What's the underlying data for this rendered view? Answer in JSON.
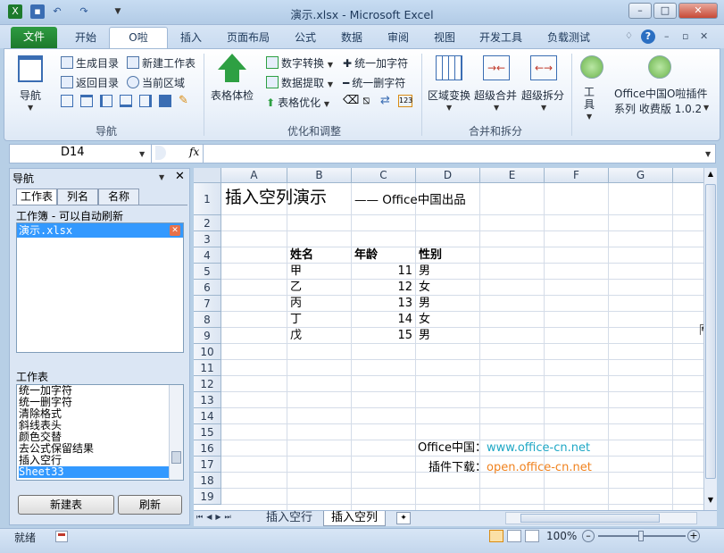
{
  "window": {
    "title": "演示.xlsx - Microsoft Excel"
  },
  "tabs": [
    "文件",
    "开始",
    "O啦",
    "插入",
    "页面布局",
    "公式",
    "数据",
    "审阅",
    "视图",
    "开发工具",
    "负载测试"
  ],
  "ribbon": {
    "nav_label": "导航",
    "nav_items": [
      "生成目录",
      "新建工作表",
      "返回目录",
      "当前区域"
    ],
    "group_nav": "导航",
    "table_check": "表格体检",
    "opt_items": [
      "数字转换",
      "统一加字符",
      "数据提取",
      "统一删字符",
      "表格优化"
    ],
    "group_opt": "优化和调整",
    "merge_items": [
      "区域变换",
      "超级合并",
      "超级拆分"
    ],
    "group_merge": "合并和拆分",
    "tools": "工具",
    "plugin_line1": "Office中国O啦插件",
    "plugin_line2": "系列 收费版 1.0.2"
  },
  "formula_bar": {
    "name_box": "D14",
    "fx": "fx"
  },
  "nav_pane": {
    "title": "导航",
    "tabs": [
      "工作表",
      "列名",
      "名称"
    ],
    "workbook_label": "工作簿 - 可以自动刷新",
    "workbook_item": "演示.xlsx",
    "sheets_label": "工作表",
    "sheets": [
      "统一加字符",
      "统一删字符",
      "清除格式",
      "斜线表头",
      "颜色交替",
      "去公式保留结果",
      "插入空行",
      "Sheet33"
    ],
    "new_sheet_button": "新建表",
    "refresh_button": "刷新"
  },
  "grid": {
    "columns": [
      "A",
      "B",
      "C",
      "D",
      "E",
      "F",
      "G"
    ],
    "rows": [
      "1",
      "2",
      "3",
      "4",
      "5",
      "6",
      "7",
      "8",
      "9",
      "10",
      "11",
      "12",
      "13",
      "14",
      "15",
      "16",
      "17",
      "18",
      "19"
    ],
    "title": "插入空列演示",
    "subtitle": "—— Office中国出品",
    "headers": [
      "姓名",
      "年龄",
      "性别"
    ],
    "data": [
      {
        "name": "甲",
        "age": "11",
        "gender": "男"
      },
      {
        "name": "乙",
        "age": "12",
        "gender": "女"
      },
      {
        "name": "丙",
        "age": "13",
        "gender": "男"
      },
      {
        "name": "丁",
        "age": "14",
        "gender": "女"
      },
      {
        "name": "戊",
        "age": "15",
        "gender": "男"
      }
    ],
    "site_label": "Office中国：",
    "site_url": "www.office-cn.net",
    "plugin_label": "插件下载：",
    "plugin_url": "open.office-cn.net",
    "link_color": "#1ea7c5",
    "plugin_color": "#f0821e"
  },
  "sheet_tabs": [
    "插入空行",
    "插入空列"
  ],
  "status": {
    "ready": "就绪",
    "zoom": "100%"
  }
}
